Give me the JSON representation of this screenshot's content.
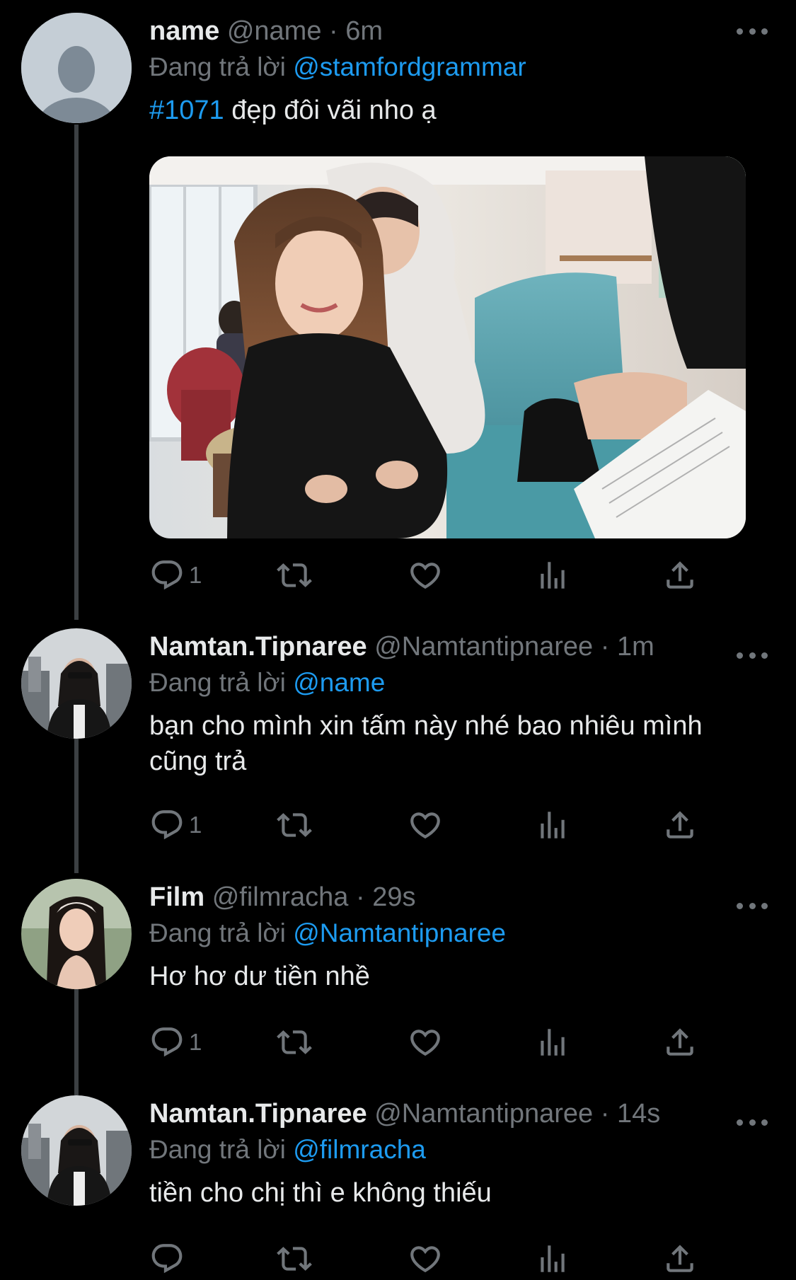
{
  "tweets": [
    {
      "display_name": "name",
      "handle": "@name",
      "time": "6m",
      "reply_prefix": "Đang trả lời",
      "reply_to": "@stamfordgrammar",
      "hashtag": "#1071",
      "text": " đẹp đôi vãi nho ạ",
      "reply_count": "1",
      "avatar": "default-profile-icon"
    },
    {
      "display_name": "Namtan.Tipnaree",
      "handle": "@Namtantipnaree",
      "time": "1m",
      "reply_prefix": "Đang trả lời",
      "reply_to": "@name",
      "text": "bạn cho mình xin tấm này nhé bao nhiêu mình cũng trả",
      "reply_count": "1"
    },
    {
      "display_name": "Film",
      "handle": "@filmracha",
      "time": "29s",
      "reply_prefix": "Đang trả lời",
      "reply_to": "@Namtantipnaree",
      "text": "Hơ hơ dư tiền nhề",
      "reply_count": "1"
    },
    {
      "display_name": "Namtan.Tipnaree",
      "handle": "@Namtantipnaree",
      "time": "14s",
      "reply_prefix": "Đang trả lời",
      "reply_to": "@filmracha",
      "text": "tiền cho chị thì e không thiếu",
      "reply_count": ""
    }
  ],
  "separator": " · ",
  "colors": {
    "background": "#000000",
    "text": "#e7e9ea",
    "muted": "#71767b",
    "accent": "#1d9bf0",
    "thread_line": "#3c4043"
  },
  "icons": [
    "reply-icon",
    "retweet-icon",
    "like-icon",
    "views-icon",
    "share-icon",
    "more-icon"
  ]
}
